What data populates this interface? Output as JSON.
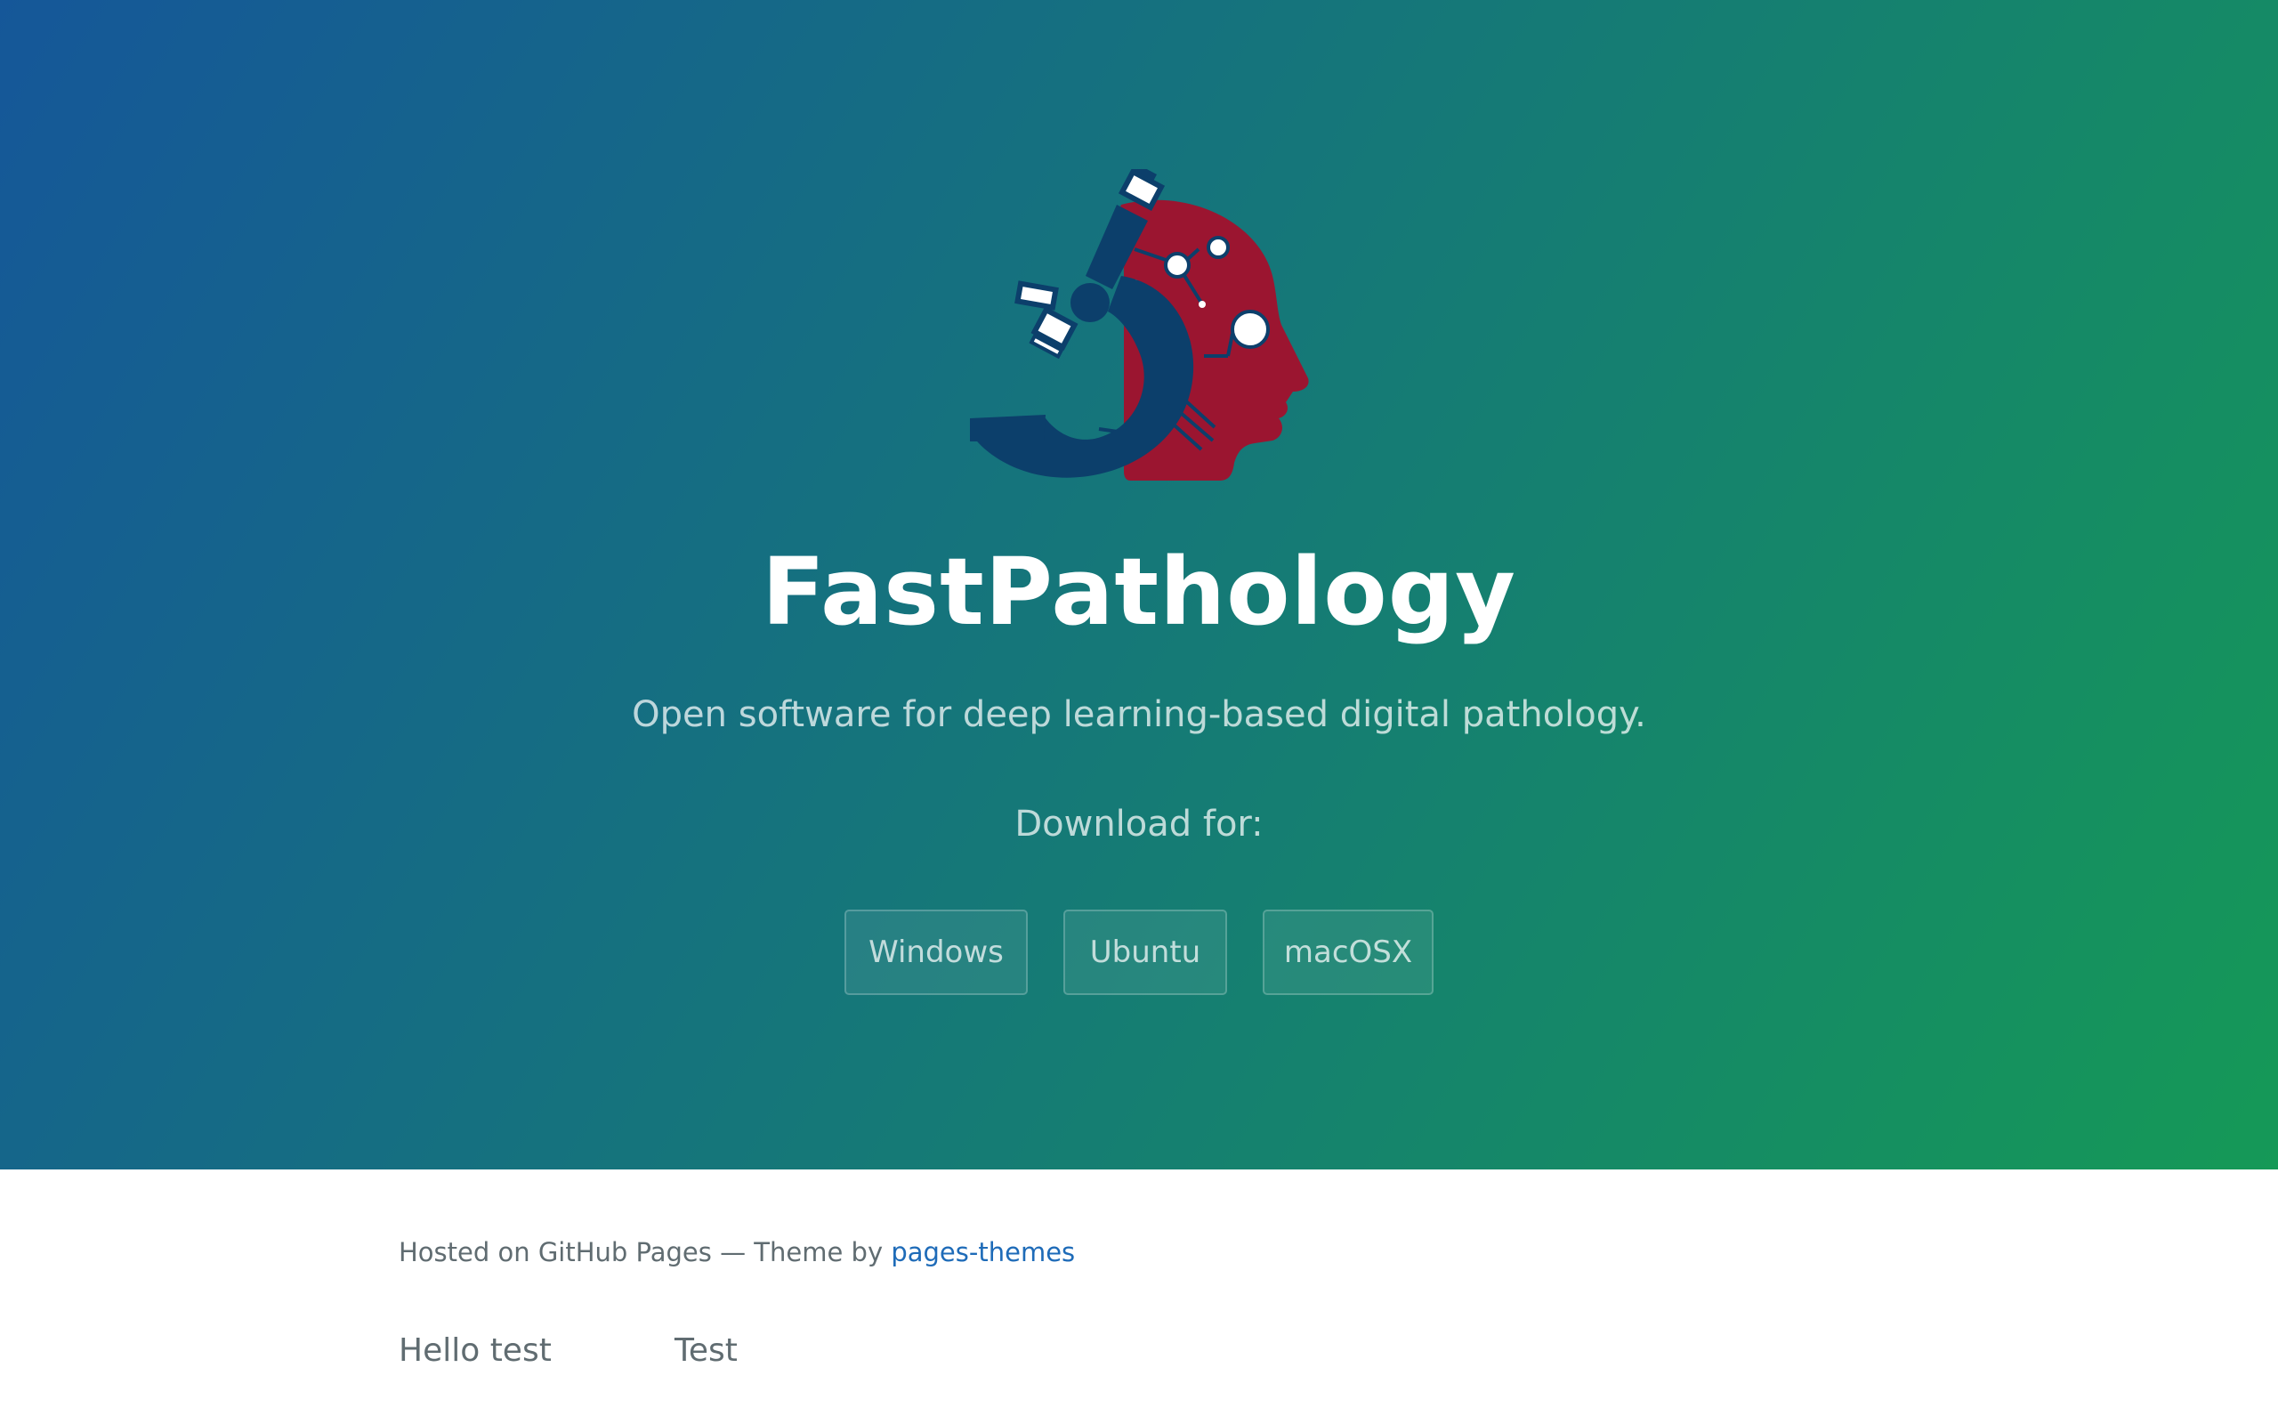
{
  "hero": {
    "title": "FastPathology",
    "tagline": "Open software for deep learning-based digital pathology.",
    "download_label": "Download for:",
    "buttons": [
      {
        "label": "Windows"
      },
      {
        "label": "Ubuntu"
      },
      {
        "label": "macOSX"
      }
    ],
    "logo_icon": "microscope-brain-logo-icon",
    "colors": {
      "gradient_start": "#155799",
      "gradient_end": "#159957",
      "logo_navy": "#0c3f6b",
      "logo_red": "#9b1530"
    }
  },
  "footer": {
    "hosted_text": "Hosted on GitHub Pages — Theme by ",
    "theme_link": "pages-themes",
    "link_color": "#1e6bb8"
  },
  "table": {
    "cells": [
      "Hello test",
      "Test"
    ]
  }
}
